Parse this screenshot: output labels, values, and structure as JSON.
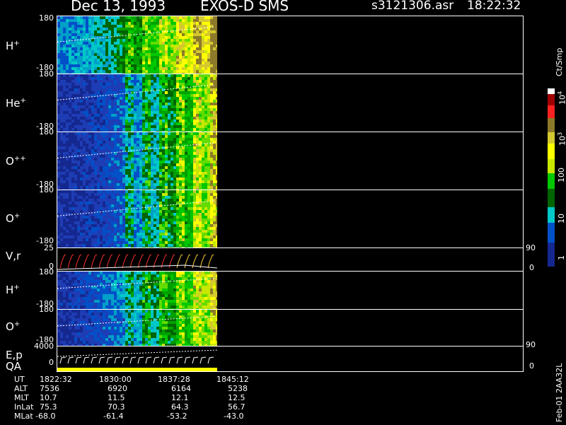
{
  "header": {
    "date": "Dec 13, 1993",
    "instrument": "EXOS-D SMS",
    "file": "s3121306.asr",
    "time": "18:22:32"
  },
  "panels": [
    {
      "id": "h",
      "label": "H",
      "sup": "+",
      "top_tick": "180",
      "bottom_tick": "-180"
    },
    {
      "id": "he",
      "label": "He",
      "sup": "+",
      "top_tick": "180",
      "bottom_tick": "-180"
    },
    {
      "id": "opp",
      "label": "O",
      "sup": "++",
      "top_tick": "180",
      "bottom_tick": "-180"
    },
    {
      "id": "op",
      "label": "O",
      "sup": "+",
      "top_tick": "180",
      "bottom_tick": "-180"
    },
    {
      "id": "vr",
      "label": "V,r",
      "sup": "",
      "top_tick": "25",
      "bottom_tick": "0",
      "right_top": "90",
      "right_bottom": "0"
    },
    {
      "id": "h2",
      "label": "H",
      "sup": "+",
      "top_tick": "180",
      "bottom_tick": "-180"
    },
    {
      "id": "o2",
      "label": "O",
      "sup": "+",
      "top_tick": "180",
      "bottom_tick": "-180"
    },
    {
      "id": "ep",
      "label": "E,p",
      "sup": "",
      "label2": "QA",
      "top_tick": "4000",
      "bottom_tick": "0",
      "right_top": "90",
      "right_bottom": "0"
    }
  ],
  "colorbar": {
    "unit": "Ct/Smp",
    "labels": [
      "10",
      "4",
      "10",
      "3",
      "100",
      "10",
      "1"
    ],
    "colors": [
      "#ffffff",
      "#a00000",
      "#ff2020",
      "#8c7a2a",
      "#d4c830",
      "#ffff00",
      "#c8e800",
      "#00c800",
      "#006400",
      "#00c8c8",
      "#0050c8",
      "#142890"
    ]
  },
  "table": {
    "rows": [
      {
        "name": "UT",
        "values": [
          "1822:32",
          "1830:00",
          "1837:28",
          "1845:12"
        ]
      },
      {
        "name": "ALT",
        "values": [
          "7536",
          "6920",
          "6164",
          "5238"
        ]
      },
      {
        "name": "MLT",
        "values": [
          "10.7",
          "11.5",
          "12.1",
          "12.5"
        ]
      },
      {
        "name": "InLat",
        "values": [
          "75.3",
          "70.3",
          "64.3",
          "56.7"
        ]
      },
      {
        "name": "MLat",
        "values": [
          "-68.0",
          "-61.4",
          "-53.2",
          "-43.0"
        ]
      }
    ]
  },
  "footer": "Feb-01 2AA32L"
}
